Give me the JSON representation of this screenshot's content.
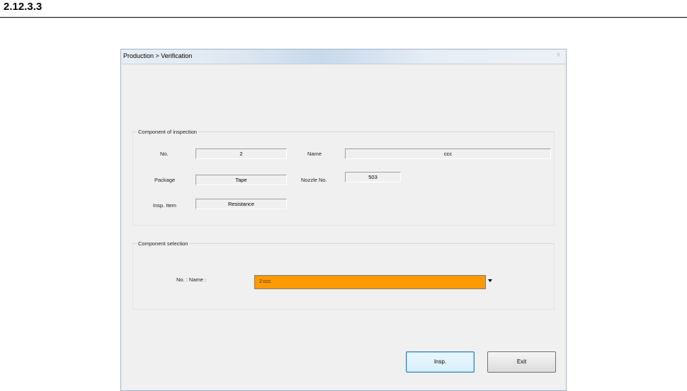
{
  "section_heading": "2.12.3.3",
  "window": {
    "title": "Production > Verification",
    "close_glyph": "x"
  },
  "inspection_group": {
    "title": "Component of inspection",
    "no_label": "No.",
    "no_value": "2",
    "name_label": "Name",
    "name_value": "ccc",
    "package_label": "Package",
    "package_value": "Tape",
    "nozzle_label": "Nozzle No.",
    "nozzle_value": "503",
    "insp_item_label": "Insp. Item",
    "insp_item_value": "Resistance"
  },
  "selection_group": {
    "title": "Component selection",
    "no_name_label": "No. : Name :",
    "selected_value": "2:ccc"
  },
  "buttons": {
    "insp_label": "Insp.",
    "exit_label": "Exit"
  },
  "colors": {
    "combo_highlight": "#ff9900",
    "window_bg": "#f0f0f0"
  }
}
